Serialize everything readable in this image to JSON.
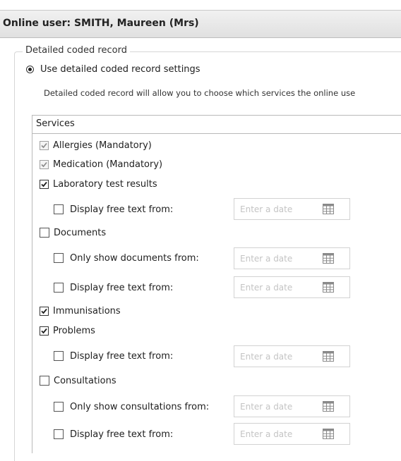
{
  "window": {
    "title": "Online user: SMITH, Maureen (Mrs)"
  },
  "detailed_record": {
    "group_label": "Detailed coded record",
    "option_label": "Use detailed coded record settings",
    "option_selected": true,
    "description": "Detailed coded record will allow you to choose which services the online use"
  },
  "services": {
    "header": "Services",
    "date_placeholder": "Enter a date",
    "items": {
      "allergies": {
        "label": "Allergies (Mandatory)",
        "checked": true,
        "disabled": true
      },
      "medication": {
        "label": "Medication (Mandatory)",
        "checked": true,
        "disabled": true
      },
      "lab_results": {
        "label": "Laboratory test results",
        "checked": true
      },
      "lab_free_text": {
        "label": "Display free text from:",
        "checked": false
      },
      "documents": {
        "label": "Documents",
        "checked": false
      },
      "documents_only_show": {
        "label": "Only show documents from:",
        "checked": false
      },
      "documents_free_text": {
        "label": "Display free text from:",
        "checked": false
      },
      "immunisations": {
        "label": "Immunisations",
        "checked": true
      },
      "problems": {
        "label": "Problems",
        "checked": true
      },
      "problems_free_text": {
        "label": "Display free text from:",
        "checked": false
      },
      "consultations": {
        "label": "Consultations",
        "checked": false
      },
      "consultations_only_show": {
        "label": "Only show consultations from:",
        "checked": false
      },
      "consultations_free_text": {
        "label": "Display free text from:",
        "checked": false
      }
    }
  },
  "icons": {
    "date_picker": "calendar-icon",
    "checkmark": "checkmark-icon"
  }
}
